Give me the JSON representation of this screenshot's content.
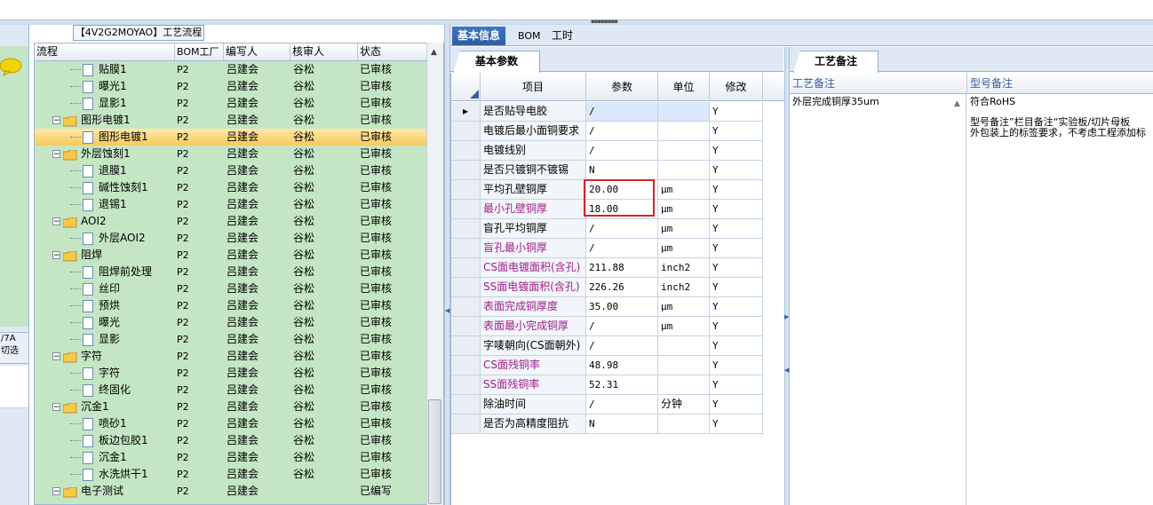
{
  "colors": {
    "tree_bg": "#c5e6c5",
    "selected_row": "#f8c95a",
    "highlight": "#d4252a",
    "purple_label": "#a0208c",
    "tab_active": "#2f5da4"
  },
  "left_stub": {
    "label_line1": "/7A",
    "label_line2": "切选",
    "icon": "chat-bubble-icon"
  },
  "tree": {
    "title": "【4V2G2MOYAO】工艺流程",
    "columns": [
      "流程",
      "BOM工厂",
      "编写人",
      "核审人",
      "状态"
    ],
    "rows": [
      {
        "level": 2,
        "type": "doc",
        "name": "贴膜1",
        "bom": "P2",
        "writer": "吕建会",
        "reviewer": "谷松",
        "status": "已审核"
      },
      {
        "level": 2,
        "type": "doc",
        "name": "曝光1",
        "bom": "P2",
        "writer": "吕建会",
        "reviewer": "谷松",
        "status": "已审核"
      },
      {
        "level": 2,
        "type": "doc",
        "name": "显影1",
        "bom": "P2",
        "writer": "吕建会",
        "reviewer": "谷松",
        "status": "已审核"
      },
      {
        "level": 1,
        "type": "folder",
        "name": "图形电镀1",
        "bom": "P2",
        "writer": "吕建会",
        "reviewer": "谷松",
        "status": "已审核"
      },
      {
        "level": 2,
        "type": "doc",
        "name": "图形电镀1",
        "bom": "P2",
        "writer": "吕建会",
        "reviewer": "谷松",
        "status": "已审核",
        "selected": true
      },
      {
        "level": 1,
        "type": "folder",
        "name": "外层蚀刻1",
        "bom": "P2",
        "writer": "吕建会",
        "reviewer": "谷松",
        "status": "已审核"
      },
      {
        "level": 2,
        "type": "doc",
        "name": "退膜1",
        "bom": "P2",
        "writer": "吕建会",
        "reviewer": "谷松",
        "status": "已审核"
      },
      {
        "level": 2,
        "type": "doc",
        "name": "碱性蚀刻1",
        "bom": "P2",
        "writer": "吕建会",
        "reviewer": "谷松",
        "status": "已审核"
      },
      {
        "level": 2,
        "type": "doc",
        "name": "退锡1",
        "bom": "P2",
        "writer": "吕建会",
        "reviewer": "谷松",
        "status": "已审核"
      },
      {
        "level": 1,
        "type": "folder",
        "name": "AOI2",
        "bom": "P2",
        "writer": "吕建会",
        "reviewer": "谷松",
        "status": "已审核"
      },
      {
        "level": 2,
        "type": "doc",
        "name": "外层AOI2",
        "bom": "P2",
        "writer": "吕建会",
        "reviewer": "谷松",
        "status": "已审核"
      },
      {
        "level": 1,
        "type": "folder",
        "name": "阻焊",
        "bom": "P2",
        "writer": "吕建会",
        "reviewer": "谷松",
        "status": "已审核"
      },
      {
        "level": 2,
        "type": "doc",
        "name": "阻焊前处理",
        "bom": "P2",
        "writer": "吕建会",
        "reviewer": "谷松",
        "status": "已审核"
      },
      {
        "level": 2,
        "type": "doc",
        "name": "丝印",
        "bom": "P2",
        "writer": "吕建会",
        "reviewer": "谷松",
        "status": "已审核"
      },
      {
        "level": 2,
        "type": "doc",
        "name": "预烘",
        "bom": "P2",
        "writer": "吕建会",
        "reviewer": "谷松",
        "status": "已审核"
      },
      {
        "level": 2,
        "type": "doc",
        "name": "曝光",
        "bom": "P2",
        "writer": "吕建会",
        "reviewer": "谷松",
        "status": "已审核"
      },
      {
        "level": 2,
        "type": "doc",
        "name": "显影",
        "bom": "P2",
        "writer": "吕建会",
        "reviewer": "谷松",
        "status": "已审核"
      },
      {
        "level": 1,
        "type": "folder",
        "name": "字符",
        "bom": "P2",
        "writer": "吕建会",
        "reviewer": "谷松",
        "status": "已审核"
      },
      {
        "level": 2,
        "type": "doc",
        "name": "字符",
        "bom": "P2",
        "writer": "吕建会",
        "reviewer": "谷松",
        "status": "已审核"
      },
      {
        "level": 2,
        "type": "doc",
        "name": "终固化",
        "bom": "P2",
        "writer": "吕建会",
        "reviewer": "谷松",
        "status": "已审核"
      },
      {
        "level": 1,
        "type": "folder",
        "name": "沉金1",
        "bom": "P2",
        "writer": "吕建会",
        "reviewer": "谷松",
        "status": "已审核"
      },
      {
        "level": 2,
        "type": "doc",
        "name": "喷砂1",
        "bom": "P2",
        "writer": "吕建会",
        "reviewer": "谷松",
        "status": "已审核"
      },
      {
        "level": 2,
        "type": "doc",
        "name": "板边包胶1",
        "bom": "P2",
        "writer": "吕建会",
        "reviewer": "谷松",
        "status": "已审核"
      },
      {
        "level": 2,
        "type": "doc",
        "name": "沉金1",
        "bom": "P2",
        "writer": "吕建会",
        "reviewer": "谷松",
        "status": "已审核"
      },
      {
        "level": 2,
        "type": "doc",
        "name": "水洗烘干1",
        "bom": "P2",
        "writer": "吕建会",
        "reviewer": "谷松",
        "status": "已审核"
      },
      {
        "level": 1,
        "type": "folder",
        "name": "电子测试",
        "bom": "P2",
        "writer": "吕建会",
        "reviewer": "",
        "status": "已编写"
      }
    ]
  },
  "tabs": [
    {
      "label": "基本信息",
      "active": true
    },
    {
      "label": "BOM",
      "active": false
    },
    {
      "label": "工时",
      "active": false
    }
  ],
  "params": {
    "subtab": "基本参数",
    "columns": [
      "项目",
      "参数",
      "单位",
      "修改"
    ],
    "rows": [
      {
        "item": "是否贴导电胶",
        "value": "/",
        "unit": "",
        "mod": "Y",
        "purple": false,
        "current": true
      },
      {
        "item": "电镀后最小面铜要求",
        "value": "/",
        "unit": "",
        "mod": "Y",
        "purple": false
      },
      {
        "item": "电镀线别",
        "value": "/",
        "unit": "",
        "mod": "Y",
        "purple": false
      },
      {
        "item": "是否只镀铜不镀锡",
        "value": "N",
        "unit": "",
        "mod": "Y",
        "purple": false
      },
      {
        "item": "平均孔壁铜厚",
        "value": "20.00",
        "unit": "μm",
        "mod": "Y",
        "purple": false
      },
      {
        "item": "最小孔壁铜厚",
        "value": "18.00",
        "unit": "μm",
        "mod": "Y",
        "purple": true
      },
      {
        "item": "盲孔平均铜厚",
        "value": "/",
        "unit": "μm",
        "mod": "Y",
        "purple": false
      },
      {
        "item": "盲孔最小铜厚",
        "value": "/",
        "unit": "μm",
        "mod": "Y",
        "purple": true
      },
      {
        "item": "CS面电镀面积(含孔)",
        "value": "211.88",
        "unit": "inch2",
        "mod": "Y",
        "purple": true
      },
      {
        "item": "SS面电镀面积(含孔)",
        "value": "226.26",
        "unit": "inch2",
        "mod": "Y",
        "purple": true
      },
      {
        "item": "表面完成铜厚度",
        "value": "35.00",
        "unit": "μm",
        "mod": "Y",
        "purple": true
      },
      {
        "item": "表面最小完成铜厚",
        "value": "/",
        "unit": "μm",
        "mod": "Y",
        "purple": true
      },
      {
        "item": "字唛朝向(CS面朝外)",
        "value": "/",
        "unit": "",
        "mod": "Y",
        "purple": false
      },
      {
        "item": "CS面残铜率",
        "value": "48.98",
        "unit": "",
        "mod": "Y",
        "purple": true
      },
      {
        "item": "SS面残铜率",
        "value": "52.31",
        "unit": "",
        "mod": "Y",
        "purple": true
      },
      {
        "item": "除油时间",
        "value": "/",
        "unit": "分钟",
        "mod": "Y",
        "purple": false
      },
      {
        "item": "是否为高精度阻抗",
        "value": "N",
        "unit": "",
        "mod": "Y",
        "purple": false
      }
    ]
  },
  "remarks": {
    "tab": "工艺备注",
    "col1": "工艺备注",
    "col2": "型号备注",
    "col1_text": "外层完成铜厚35um",
    "col2_line1": "符合RoHS",
    "col2_line2": "型号备注”栏目备注“实验板/切片母板",
    "col2_line3": "外包装上的标签要求，不考虑工程添加标"
  }
}
